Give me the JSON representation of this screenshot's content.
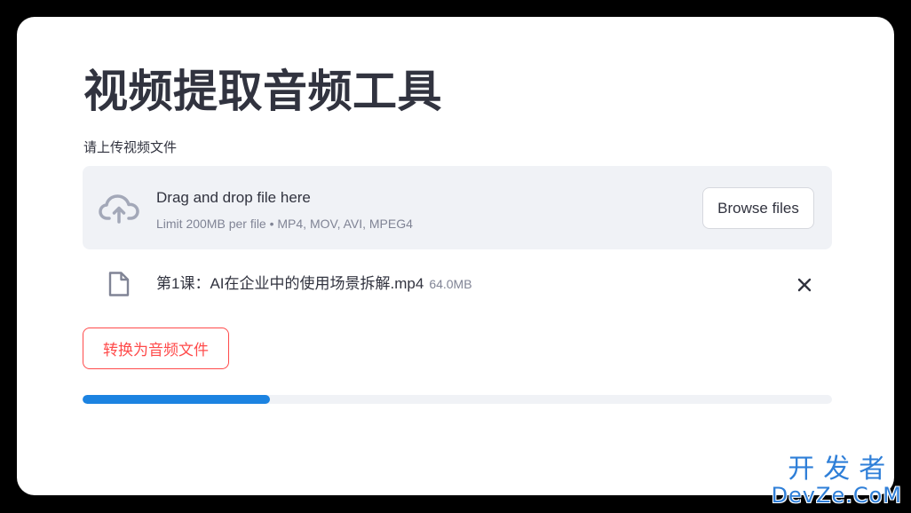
{
  "page": {
    "title": "视频提取音频工具"
  },
  "uploader": {
    "label": "请上传视频文件",
    "drop_title": "Drag and drop file here",
    "drop_limit": "Limit 200MB per file • MP4, MOV, AVI, MPEG4",
    "browse_label": "Browse files",
    "upload_icon": "cloud-upload-icon"
  },
  "uploaded_file": {
    "name": "第1课：AI在企业中的使用场景拆解.mp4",
    "size": "64.0MB",
    "file_icon": "file-icon",
    "remove_icon": "close-icon"
  },
  "actions": {
    "convert_label": "转换为音频文件"
  },
  "progress": {
    "fraction": 0.25
  },
  "watermark": {
    "line1": "开发者",
    "line2": "DevZe.CoM"
  },
  "colors": {
    "accent_red": "#ff4b4b",
    "progress_blue": "#1c83e1",
    "text_dark": "#31333f",
    "text_muted": "#808495",
    "dropzone_bg": "#f0f2f6",
    "watermark_blue": "#2f7fd8"
  }
}
